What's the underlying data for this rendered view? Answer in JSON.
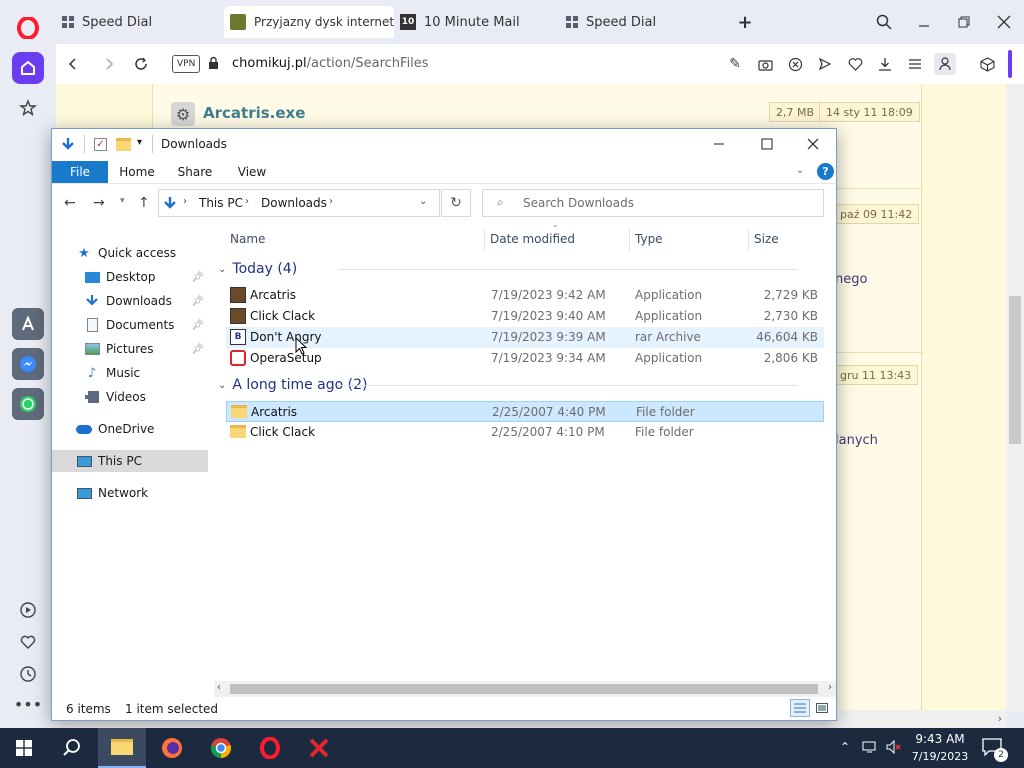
{
  "browser": {
    "tabs": [
      {
        "label": "Speed Dial"
      },
      {
        "label": "Przyjazny dysk internetow"
      },
      {
        "label": "10 Minute Mail"
      },
      {
        "label": "Speed Dial"
      }
    ],
    "vpn": "VPN",
    "url_domain": "chomikuj.pl",
    "url_path": "/action/SearchFiles"
  },
  "web": {
    "file_title": "Arcatris.exe",
    "file_size": "2,7 MB",
    "file_date": "14 sty 11 18:09",
    "date2": "paź 09 11:42",
    "date3": "gru 11 13:43",
    "frag1": "nego",
    "frag2": "lanych"
  },
  "explorer": {
    "title": "Downloads",
    "ribbon": {
      "file": "File",
      "home": "Home",
      "share": "Share",
      "view": "View"
    },
    "breadcrumb": {
      "root": "This PC",
      "current": "Downloads"
    },
    "search_placeholder": "Search Downloads",
    "nav": {
      "quick_access": "Quick access",
      "desktop": "Desktop",
      "downloads": "Downloads",
      "documents": "Documents",
      "pictures": "Pictures",
      "music": "Music",
      "videos": "Videos",
      "onedrive": "OneDrive",
      "thispc": "This PC",
      "network": "Network"
    },
    "columns": {
      "name": "Name",
      "date": "Date modified",
      "type": "Type",
      "size": "Size"
    },
    "groups": {
      "today": "Today (4)",
      "old": "A long time ago (2)"
    },
    "files": [
      {
        "name": "Arcatris",
        "date": "7/19/2023 9:42 AM",
        "type": "Application",
        "size": "2,729 KB"
      },
      {
        "name": "Click Clack",
        "date": "7/19/2023 9:40 AM",
        "type": "Application",
        "size": "2,730 KB"
      },
      {
        "name": "Don't Angry",
        "date": "7/19/2023 9:39 AM",
        "type": "rar Archive",
        "size": "46,604 KB"
      },
      {
        "name": "OperaSetup",
        "date": "7/19/2023 9:34 AM",
        "type": "Application",
        "size": "2,806 KB"
      },
      {
        "name": "Arcatris",
        "date": "2/25/2007 4:40 PM",
        "type": "File folder",
        "size": ""
      },
      {
        "name": "Click Clack",
        "date": "2/25/2007 4:10 PM",
        "type": "File folder",
        "size": ""
      }
    ],
    "status": {
      "items": "6 items",
      "selected": "1 item selected"
    }
  },
  "taskbar": {
    "time": "9:43 AM",
    "date": "7/19/2023",
    "notif_count": "2"
  },
  "colors": {
    "accent": "#0063b1",
    "selection": "#cce8ff",
    "opera_red": "#ff1b2d",
    "taskbar": "#1c2a3f"
  }
}
